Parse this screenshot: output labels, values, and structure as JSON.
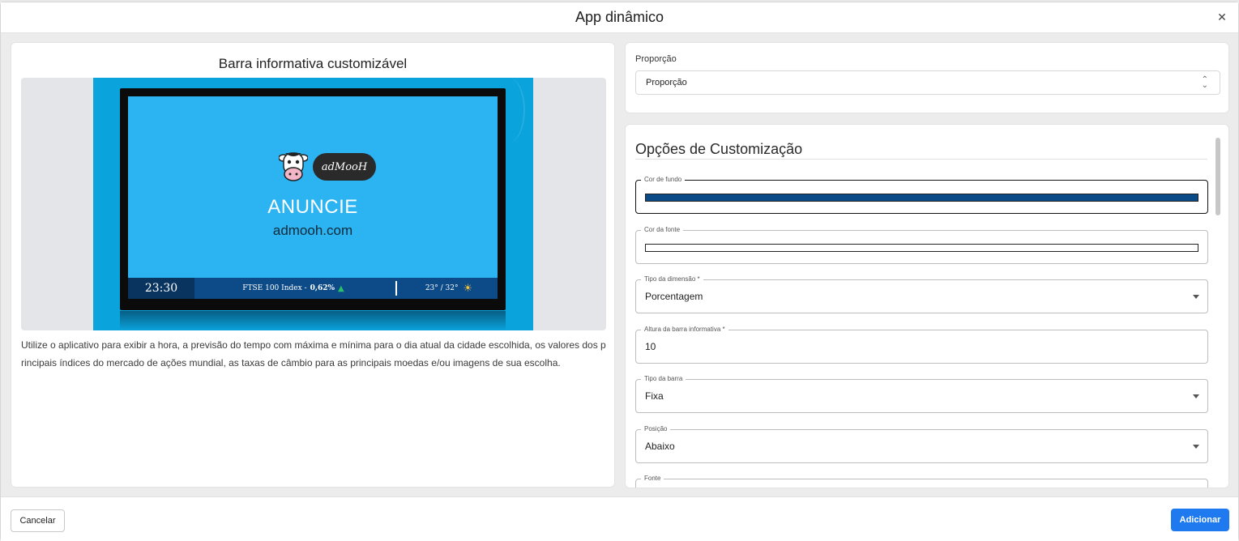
{
  "modal": {
    "title": "App dinâmico"
  },
  "preview": {
    "title": "Barra informativa customizável",
    "tv": {
      "logo_text": "adMooH",
      "headline": "ANUNCIE",
      "site": "admooh.com",
      "bar": {
        "clock": "23:30",
        "index_name": "FTSE 100 Index -",
        "index_value": "0,62%",
        "weather": "23° / 32°"
      }
    },
    "description": "Utilize o aplicativo para exibir a hora, a previsão do tempo com máxima e mínima para o dia atual da cidade escolhida, os valores dos principais índices do mercado de ações mundial, as taxas de câmbio para as principais moedas e/ou imagens de sua escolha."
  },
  "proportion": {
    "label": "Proporção",
    "value": "Proporção"
  },
  "customization": {
    "title": "Opções de Customização",
    "fields": {
      "bg_color": {
        "label": "Cor de fundo",
        "color": "#0a4a86"
      },
      "font_color": {
        "label": "Cor da fonte",
        "color": "#ffffff"
      },
      "dimension_type": {
        "label": "Tipo da dimensão *",
        "value": "Porcentagem"
      },
      "bar_height": {
        "label": "Altura da barra informativa *",
        "value": "10"
      },
      "bar_type": {
        "label": "Tipo da barra",
        "value": "Fixa"
      },
      "position": {
        "label": "Posição",
        "value": "Abaixo"
      },
      "font": {
        "label": "Fonte"
      }
    }
  },
  "footer": {
    "cancel_label": "Cancelar",
    "add_label": "Adicionar"
  },
  "colors": {
    "accent": "#1f7af0",
    "screen_blue": "#2bb3f2",
    "bar_blue": "#0c4b87"
  }
}
